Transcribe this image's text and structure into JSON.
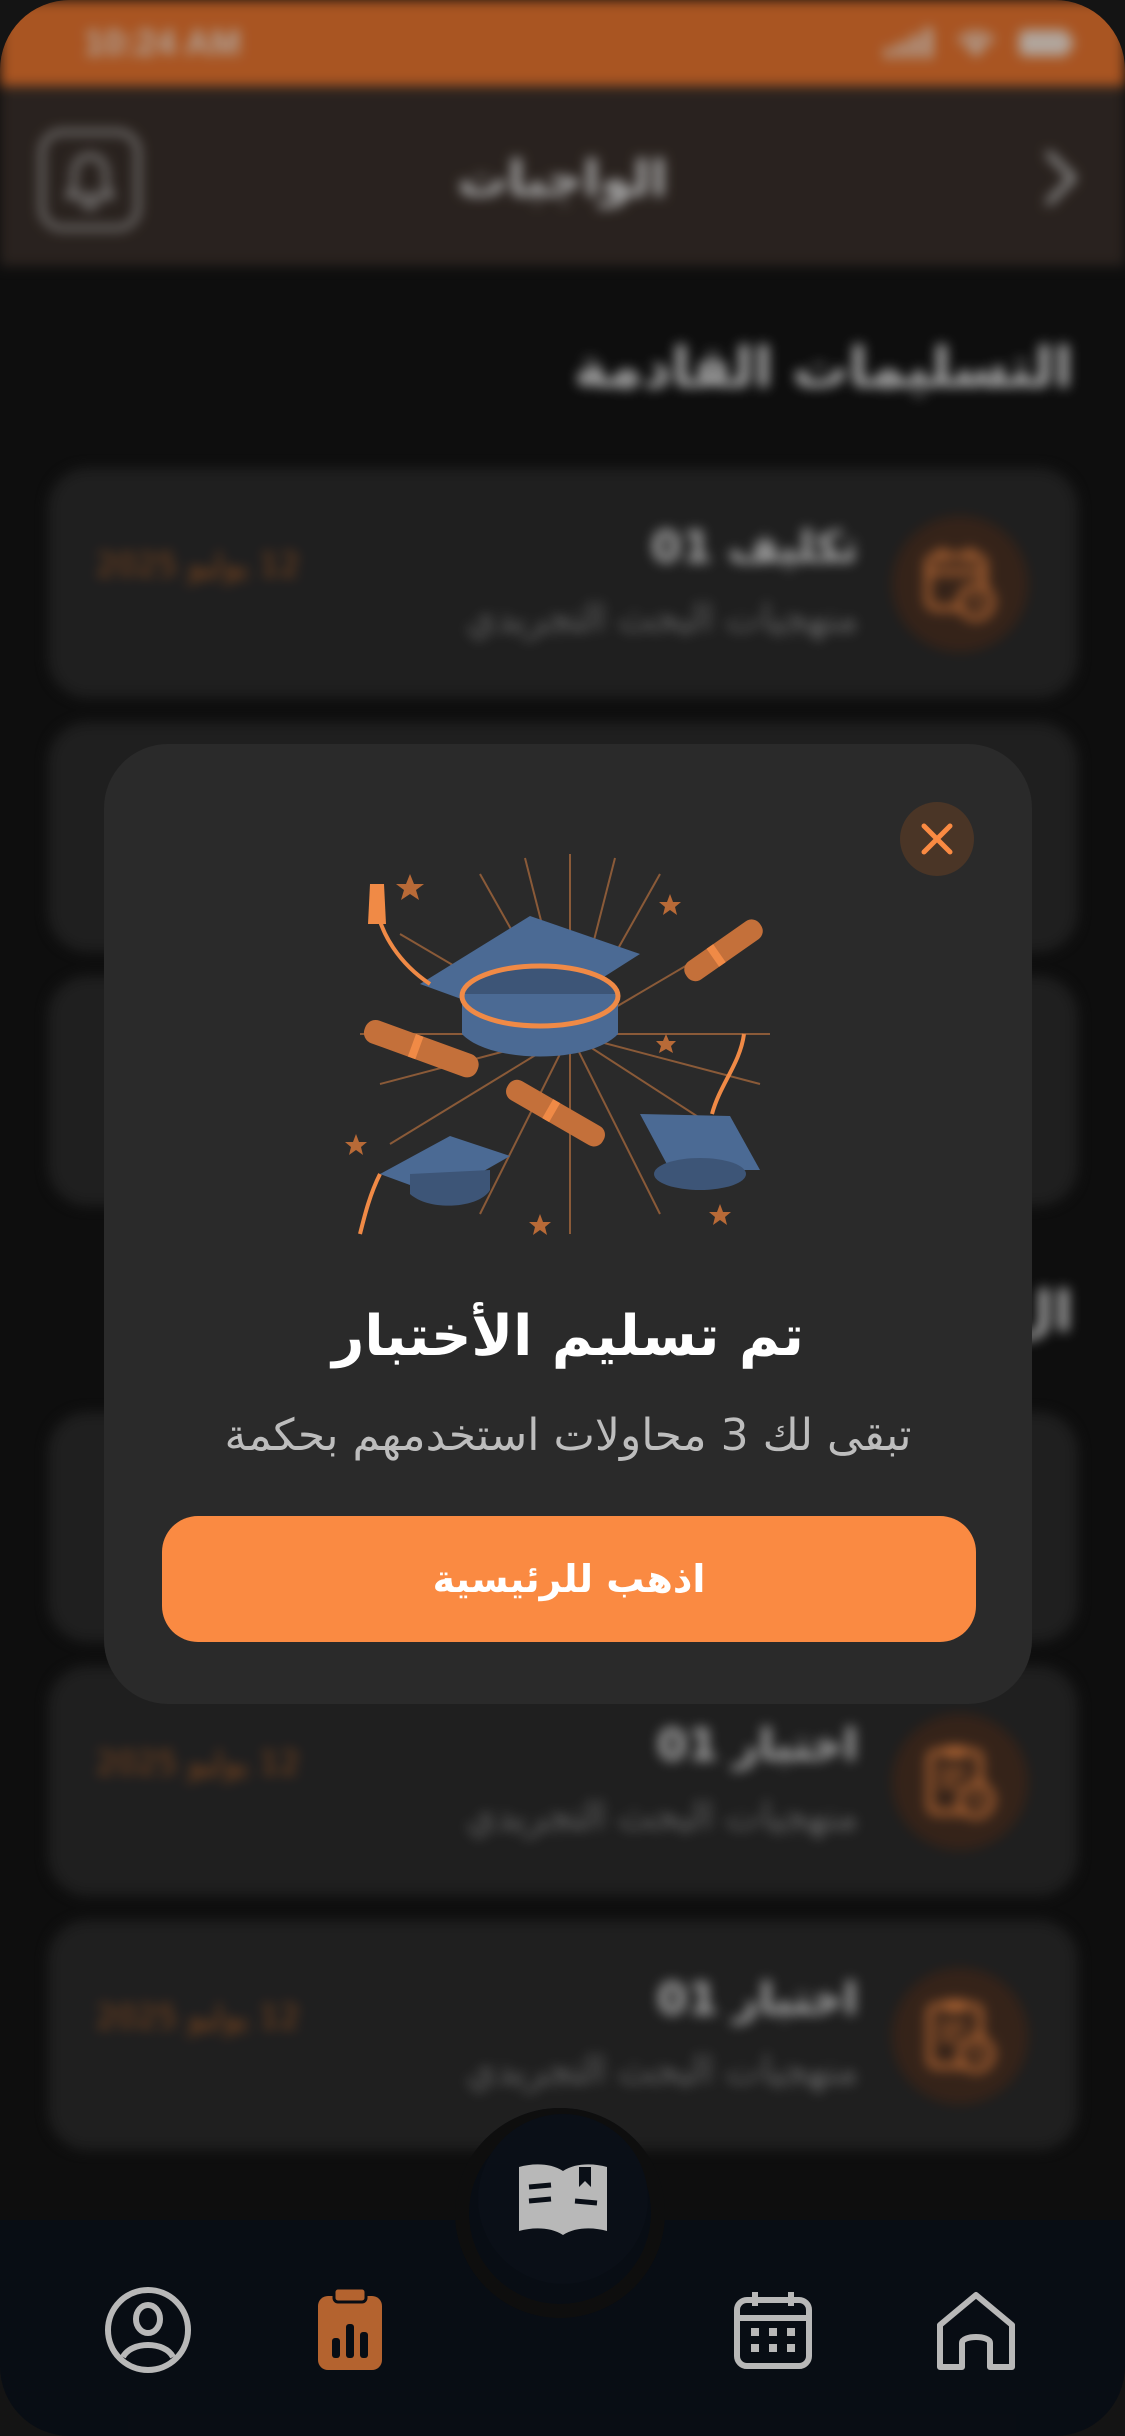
{
  "status_bar": {
    "time": "10:24 AM"
  },
  "header": {
    "title": "الواجبات"
  },
  "sections": {
    "upcoming_title": "التسليمات القادمة",
    "second_title_fragment": "ال"
  },
  "cards": [
    {
      "title": "تكليف 01",
      "subtitle": "منهجيات البحث التجريدي",
      "date": "12 يوليو 2025",
      "icon": "calendar-clock-icon"
    },
    {
      "title": "",
      "subtitle": "",
      "date": "",
      "icon": ""
    },
    {
      "title": "",
      "subtitle": "",
      "date": "",
      "icon": ""
    },
    {
      "title": "",
      "subtitle": "",
      "date": "",
      "icon": ""
    },
    {
      "title": "اختبار 01",
      "subtitle": "منهجيات البحث التجريدي",
      "date": "12 يوليو 2025",
      "icon": "clipboard-clock-icon"
    },
    {
      "title": "اختبار 01",
      "subtitle": "منهجيات البحث التجريدي",
      "date": "12 يوليو 2025",
      "icon": "clipboard-clock-icon"
    }
  ],
  "modal": {
    "title": "تم تسليم الأختبار",
    "subtitle": "تبقى لك 3 محاولات استخدمهم بحكمة",
    "button": "اذهب للرئيسية",
    "illustration": "graduation-caps-illustration"
  },
  "navbar": {
    "items": [
      "profile-icon",
      "assignments-icon",
      "book-icon",
      "calendar-icon",
      "home-icon"
    ],
    "active": "assignments-icon"
  },
  "colors": {
    "accent": "#fa8a42",
    "status_bar": "#ea7630",
    "header": "#3a302b",
    "background": "#141414",
    "card": "#2b2b2b",
    "modal": "#2a2a2a",
    "navbar": "#0c121c"
  }
}
